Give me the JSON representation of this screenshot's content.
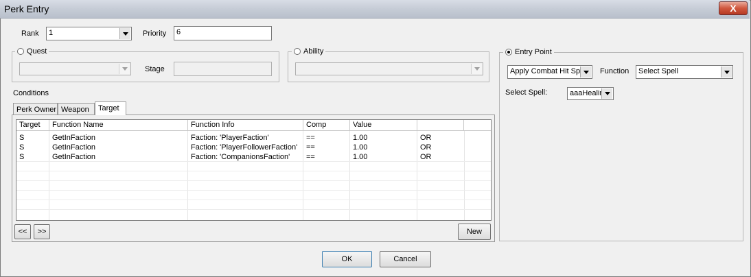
{
  "window": {
    "title": "Perk Entry",
    "close_glyph": "X"
  },
  "rank": {
    "label": "Rank",
    "value": "1"
  },
  "priority": {
    "label": "Priority",
    "value": "6"
  },
  "quest": {
    "label": "Quest",
    "value": "",
    "stage_label": "Stage",
    "stage_value": ""
  },
  "ability": {
    "label": "Ability",
    "value": ""
  },
  "entry_point": {
    "label": "Entry Point",
    "value": "Apply Combat Hit Spe",
    "function_label": "Function",
    "function_value": "Select Spell",
    "select_spell_label": "Select Spell:",
    "select_spell_value": "aaaHealin"
  },
  "conditions": {
    "label": "Conditions",
    "tabs": [
      {
        "label": "Perk Owner"
      },
      {
        "label": "Weapon"
      },
      {
        "label": "Target"
      }
    ],
    "active_tab": "Target",
    "columns": [
      "Target",
      "Function Name",
      "Function Info",
      "Comp",
      "Value",
      ""
    ],
    "rows": [
      [
        "S",
        "GetInFaction",
        "Faction: 'PlayerFaction'",
        "==",
        "1.00",
        "OR"
      ],
      [
        "S",
        "GetInFaction",
        "Faction: 'PlayerFollowerFaction'",
        "==",
        "1.00",
        "OR"
      ],
      [
        "S",
        "GetInFaction",
        "Faction: 'CompanionsFaction'",
        "==",
        "1.00",
        "OR"
      ]
    ],
    "prev_label": "<<",
    "next_label": ">>",
    "new_label": "New"
  },
  "buttons": {
    "ok": "OK",
    "cancel": "Cancel"
  }
}
